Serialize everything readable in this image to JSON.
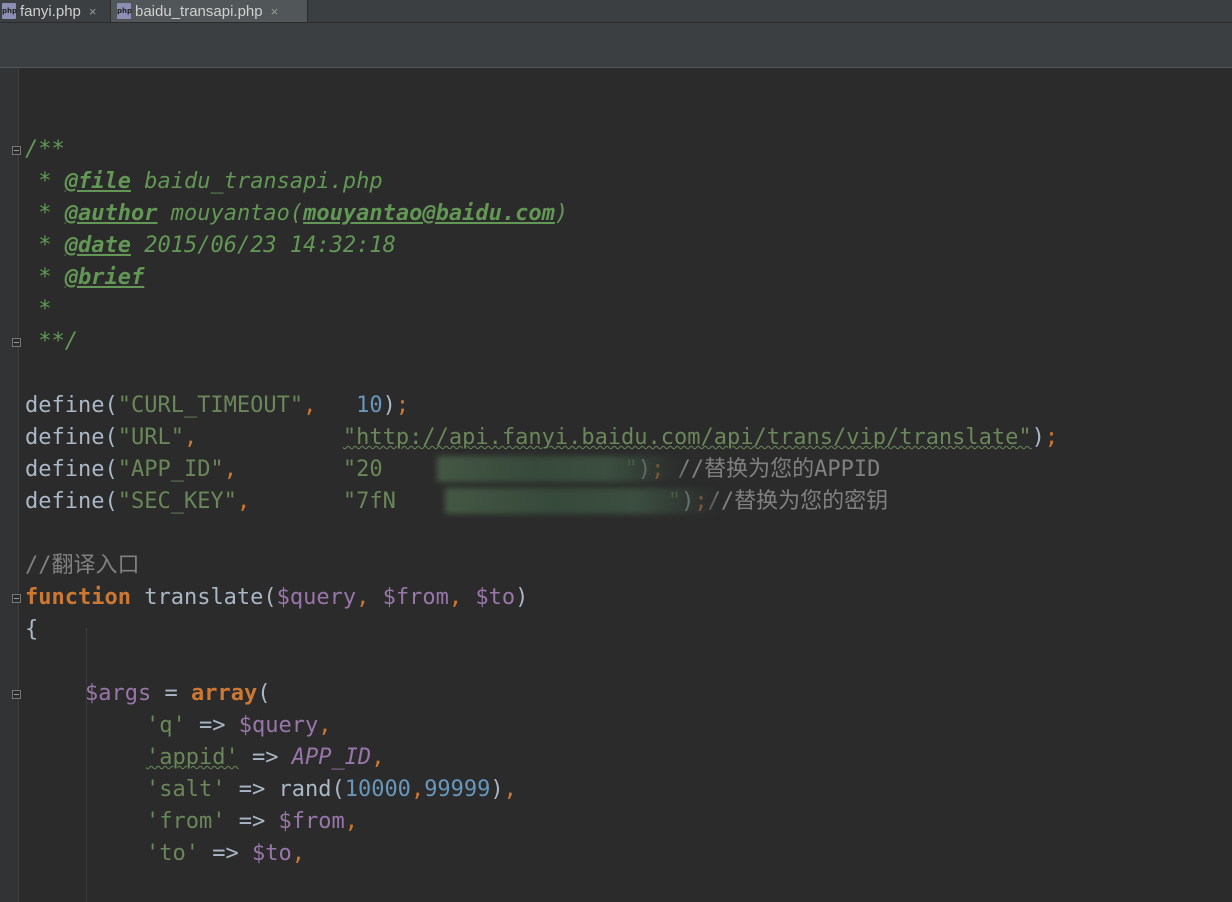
{
  "tabs": [
    {
      "label": "fanyi.php",
      "icon": "php-file-icon",
      "close": "×"
    },
    {
      "label": "baidu_transapi.php",
      "icon": "php-file-icon",
      "close": "×"
    }
  ],
  "code": {
    "doc_open": "/**",
    "star": " * ",
    "file_tag": "@file",
    "file_val": " baidu_transapi.php",
    "author_tag": "@author",
    "author_val": " mouyantao(",
    "author_email": "mouyantao@baidu.com",
    "author_close": ")",
    "date_tag": "@date",
    "date_val": " 2015/06/23 14:32:18",
    "brief_tag": "@brief",
    "star_only": " *",
    "doc_close": " **/",
    "define": "define(",
    "paren_close": ")",
    "semicolon": ";",
    "comma": ",",
    "d1_key": "\"CURL_TIMEOUT\"",
    "d1_pad": "   ",
    "d1_val": "10",
    "d2_key": "\"URL\"",
    "d2_pad": "           ",
    "d2_val": "\"http://api.fanyi.baidu.com/api/trans/vip/translate\"",
    "d3_key": "\"APP_ID\"",
    "d3_pad": "        ",
    "d3_val_start": "\"20",
    "d3_val_end": "\"",
    "d3_comment": " //替换为您的APPID",
    "d4_key": "\"SEC_KEY\"",
    "d4_pad": "       ",
    "d4_val_start": "\"7fN",
    "d4_val_end": "\"",
    "d4_comment": "//替换为您的密钥",
    "entry_comment": "//翻译入口",
    "func_kw": "function",
    "func_name": " translate(",
    "p_query": "$query",
    "p_from": "$from",
    "p_to": "$to",
    "sep": ", ",
    "brace_open": "{",
    "args_var": "$args",
    "assign": " = ",
    "array_kw": "array",
    "paren_open": "(",
    "q_key": "'q'",
    "arrow": " => ",
    "appid_key": "'appid'",
    "appid_const": "APP_ID",
    "salt_key": "'salt'",
    "rand_fn": "rand(",
    "rand_a": "10000",
    "rand_b": "99999",
    "from_key": "'from'",
    "to_key": "'to'"
  }
}
